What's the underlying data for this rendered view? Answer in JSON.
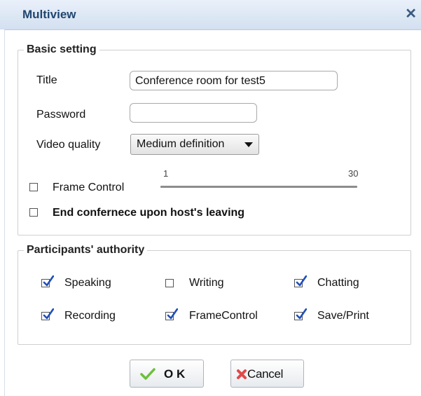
{
  "window": {
    "title": "Multiview",
    "close_icon": "close-icon"
  },
  "basic": {
    "legend": "Basic setting",
    "title_label": "Title",
    "title_value": "Conference room for test5",
    "password_label": "Password",
    "password_value": "",
    "video_label": "Video quality",
    "video_value": "Medium definition",
    "frame_control_label": "Frame Control",
    "frame_control_checked": false,
    "slider_min": "1",
    "slider_max": "30",
    "end_conference_label": "End confernece upon host's leaving",
    "end_conference_checked": false
  },
  "authority": {
    "legend": "Participants' authority",
    "items": [
      {
        "label": "Speaking",
        "checked": true
      },
      {
        "label": "Writing",
        "checked": false
      },
      {
        "label": "Chatting",
        "checked": true
      },
      {
        "label": "Recording",
        "checked": true
      },
      {
        "label": "FrameControl",
        "checked": true
      },
      {
        "label": "Save/Print",
        "checked": true
      }
    ]
  },
  "buttons": {
    "ok": "O K",
    "cancel": "Cancel"
  },
  "colors": {
    "check_blue": "#1f4fb8",
    "ok_green": "#6cbf3c",
    "cancel_red": "#e04a4a",
    "title_text": "#20466f"
  }
}
